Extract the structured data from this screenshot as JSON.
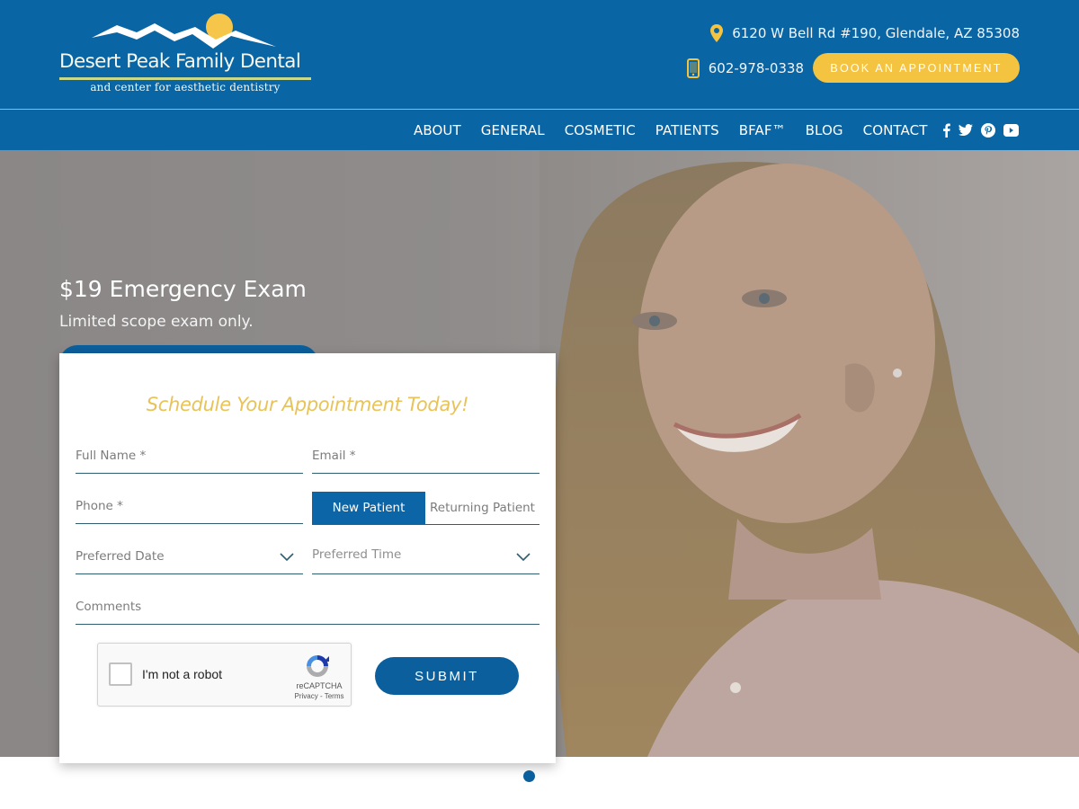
{
  "header": {
    "logo": {
      "title": "Desert Peak Family Dental",
      "subtitle": "and center for aesthetic dentistry"
    },
    "address": "6120 W Bell Rd #190, Glendale, AZ 85308",
    "phone": "602-978-0338",
    "book_button": "BOOK AN APPOINTMENT",
    "icons": {
      "address": "map-pin-icon",
      "phone": "mobile-phone-icon"
    }
  },
  "nav": {
    "items": [
      {
        "label": "ABOUT"
      },
      {
        "label": "GENERAL"
      },
      {
        "label": "COSMETIC"
      },
      {
        "label": "PATIENTS"
      },
      {
        "label": "BFAF™"
      },
      {
        "label": "BLOG"
      },
      {
        "label": "CONTACT"
      }
    ],
    "social": [
      "facebook-icon",
      "twitter-icon",
      "pinterest-icon",
      "youtube-icon"
    ]
  },
  "hero": {
    "title": "$19 Emergency Exam",
    "subtitle": "Limited scope exam only."
  },
  "form": {
    "title": "Schedule Your Appointment Today!",
    "full_name_placeholder": "Full Name *",
    "email_placeholder": "Email *",
    "phone_placeholder": "Phone *",
    "patient_type": {
      "options": [
        "New Patient",
        "Returning Patient"
      ],
      "selected": "New Patient"
    },
    "preferred_date_placeholder": "Preferred Date",
    "preferred_time_placeholder": "Preferred Time",
    "comments_placeholder": "Comments",
    "captcha": {
      "label": "I'm not a robot",
      "brand": "reCAPTCHA",
      "links": "Privacy - Terms"
    },
    "submit_label": "SUBMIT"
  },
  "slider": {
    "active_index": 0,
    "count": 1
  },
  "colors": {
    "brand_blue": "#0965a4",
    "accent_yellow": "#f4c340",
    "title_gold": "#e8c35a"
  }
}
